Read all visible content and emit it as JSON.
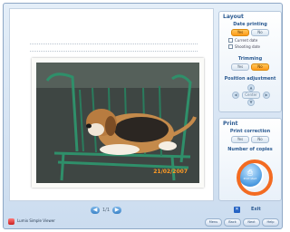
{
  "preview": {
    "date_stamp": "21/02/2007",
    "pager": {
      "prev": "◀",
      "page": "1/1",
      "next": "▶"
    }
  },
  "layout_panel": {
    "title": "Layout",
    "date_printing": {
      "label": "Date printing",
      "yes": "Yes",
      "no": "No",
      "selected": "yes"
    },
    "date_options": [
      "Current date",
      "Shooting date"
    ],
    "trimming": {
      "label": "Trimming",
      "yes": "Yes",
      "no": "No",
      "selected": "no"
    },
    "position_adjustment": {
      "label": "Position adjustment",
      "center": "Center"
    }
  },
  "print_panel": {
    "title": "Print",
    "print_correction": {
      "label": "Print correction",
      "yes": "Yes",
      "no": "No"
    },
    "number_of_copies": {
      "label": "Number of copies"
    },
    "print_button_label": "Print start",
    "exit_label": "Exit"
  },
  "footer": {
    "app_title": "Lumix Simple Viewer",
    "nav_buttons": [
      "Menu",
      "Back",
      "Next",
      "Help"
    ]
  },
  "colors": {
    "accent": "#f36b21",
    "brand_blue": "#2b5a91",
    "selected_orange": "#ff9a18"
  }
}
